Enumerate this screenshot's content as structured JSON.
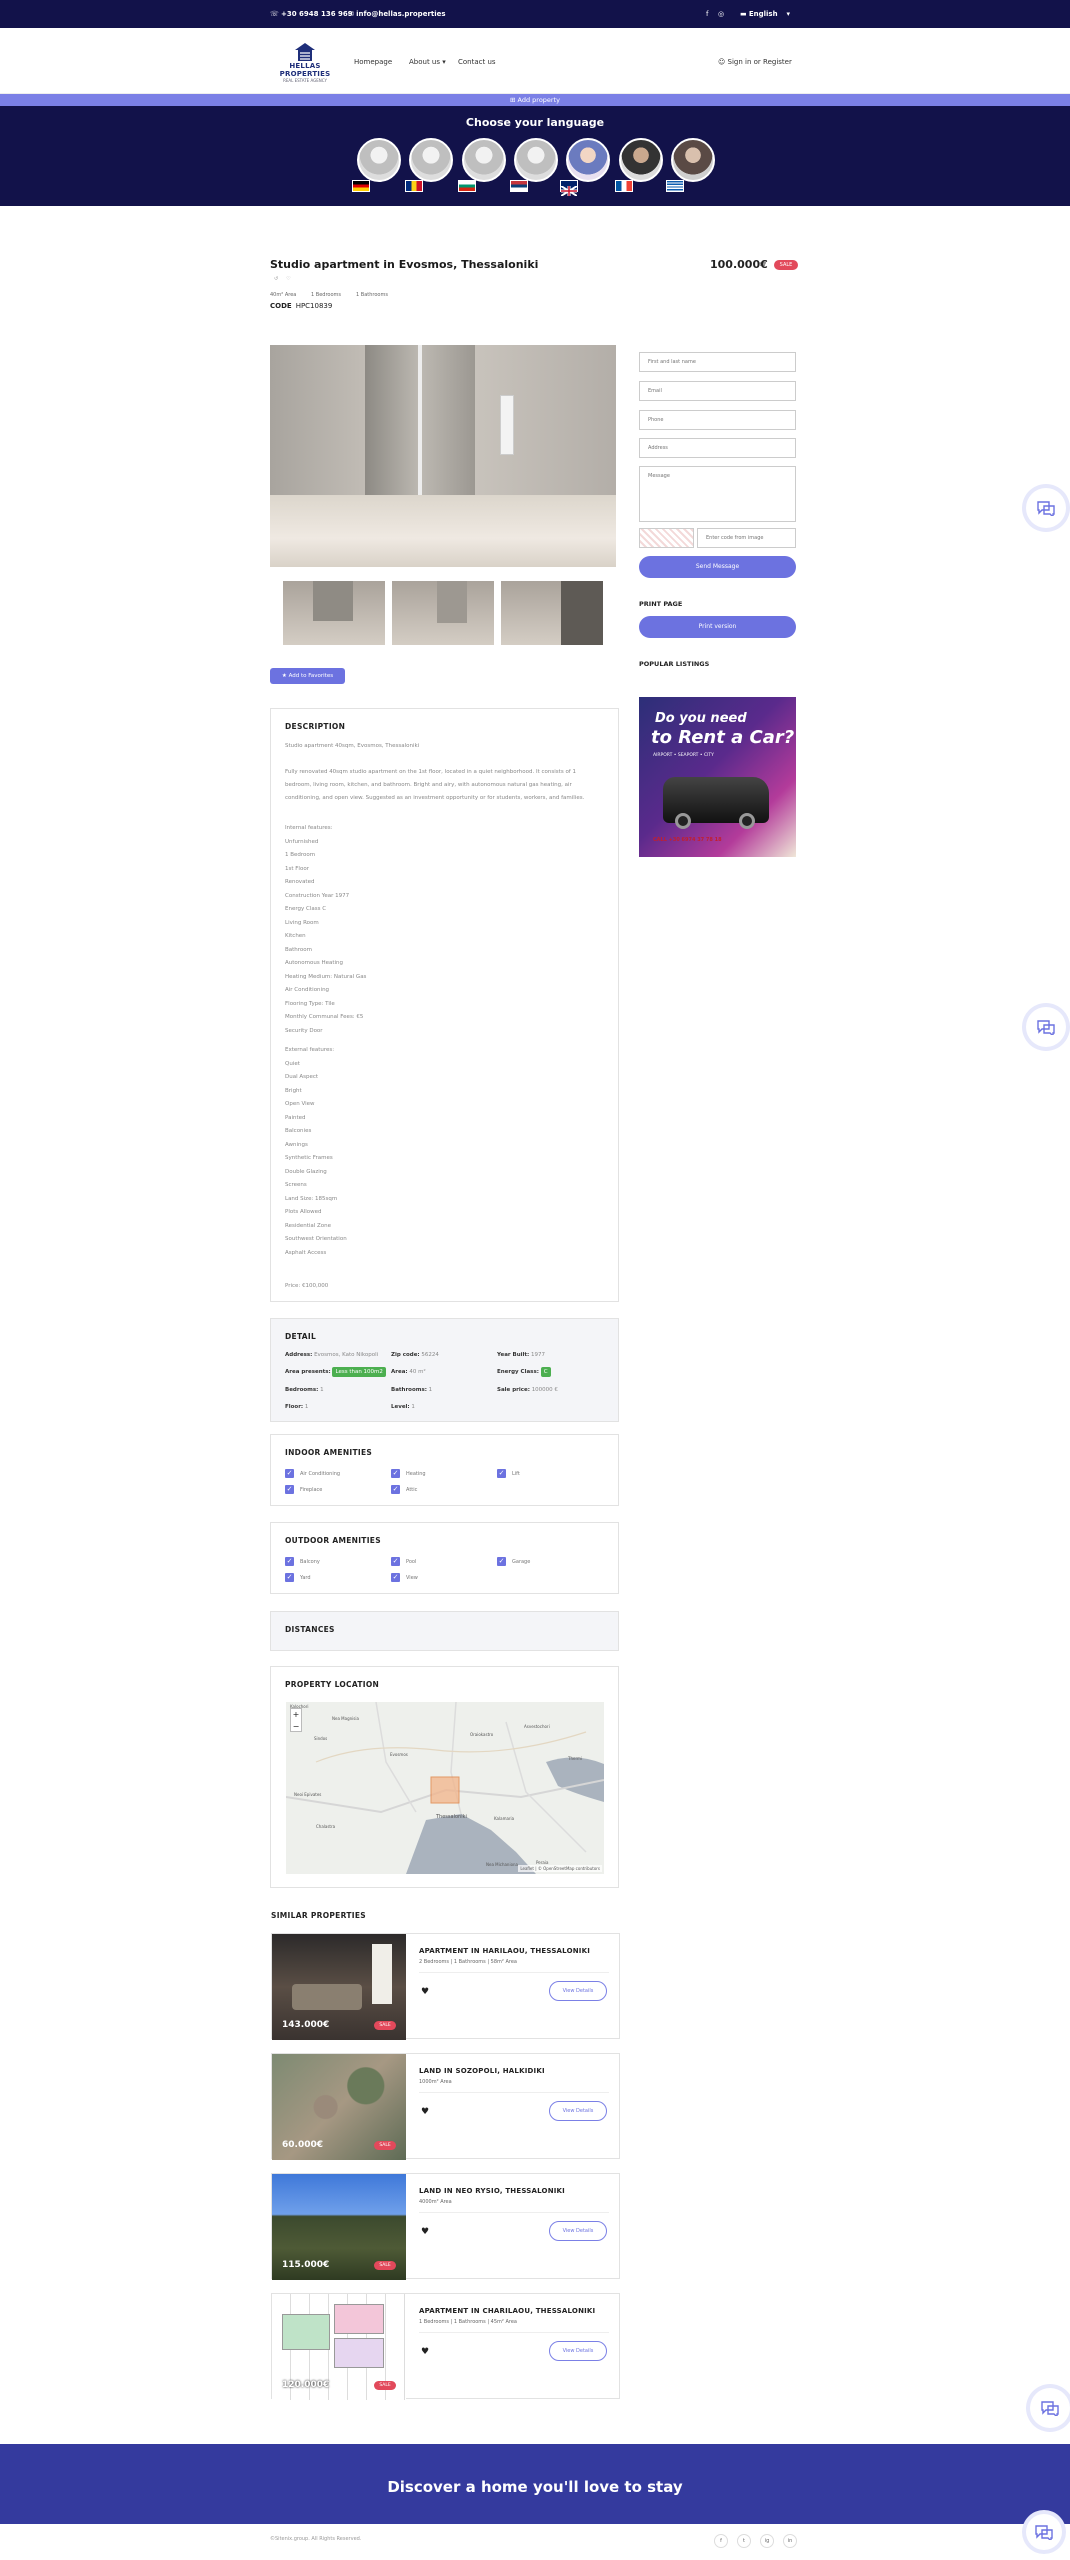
{
  "topbar": {
    "phone": "+30 6948 136 969",
    "email": "info@hellas.properties",
    "language": "English"
  },
  "header": {
    "logo_name": "HELLAS PROPERTIES",
    "logo_tag": "REAL ESTATE AGENCY",
    "nav": [
      "Homepage",
      "About us",
      "Contact us"
    ],
    "signin": "Sign in or Register"
  },
  "addbar": {
    "label": "Add property"
  },
  "language_bar": {
    "title": "Choose your language"
  },
  "property": {
    "title": "Studio apartment in Evosmos, Thessaloniki",
    "price": "100.000€",
    "badge": "SALE",
    "area": "40m² Area",
    "bedrooms": "1 Bedrooms",
    "bathrooms": "1 Bathrooms",
    "code_label": "CODE",
    "code_value": "HPC10839"
  },
  "favorites_button": "Add to Favorites",
  "description": {
    "title": "DESCRIPTION",
    "intro": "Studio apartment 40sqm, Evosmos, Thessaloniki",
    "para1": "Fully renovated 40sqm studio apartment on the 1st floor, located in a quiet neighborhood. It consists of 1",
    "para2": "bedroom, living room, kitchen, and bathroom. Bright and airy, with autonomous natural gas heating, air",
    "para3": "conditioning, and open view. Suggested as an investment opportunity or for students, workers, and families.",
    "internal": [
      "Internal features:",
      "Unfurnished",
      "1 Bedroom",
      "1st Floor",
      "Renovated",
      "Construction Year 1977",
      "Energy Class C",
      "Living Room",
      "Kitchen",
      "Bathroom",
      "Autonomous Heating",
      "Heating Medium: Natural Gas",
      "Air Conditioning",
      "Flooring Type: Tile",
      "Monthly Communal Fees: €5",
      "Security Door"
    ],
    "external": [
      "External features:",
      "Quiet",
      "Dual Aspect",
      "Bright",
      "Open View",
      "Painted",
      "Balconies",
      "Awnings",
      "Synthetic Frames",
      "Double Glazing",
      "Screens",
      "Land Size: 185sqm",
      "Plots Allowed",
      "Residential Zone",
      "Southwest Orientation",
      "Asphalt Access"
    ],
    "price_line": "Price: €100,000"
  },
  "detail": {
    "title": "DETAIL",
    "address_label": "Address:",
    "address": "Evosmos, Kato Nikopoli",
    "zip_label": "Zip code:",
    "zip": "56224",
    "year_label": "Year Built:",
    "year": "1977",
    "area_label": "Area presents:",
    "area_badge": "Less than 100m2",
    "areas_label": "Area:",
    "areas": "40 m²",
    "energy_label": "Energy Class:",
    "energy": "C",
    "bedrooms_label": "Bedrooms:",
    "bedrooms": "1",
    "bathrooms_label": "Bathrooms:",
    "bathrooms": "1",
    "sale_label": "Sale price:",
    "sale": "100000 €",
    "floor_label": "Floor:",
    "floor": "1",
    "level_label": "Level:",
    "level": "1"
  },
  "indoor": {
    "title": "INDOOR AMENITIES",
    "items": [
      "Air Conditioning",
      "Heating",
      "Lift",
      "Fireplace",
      "Attic"
    ]
  },
  "outdoor": {
    "title": "OUTDOOR AMENITIES",
    "items": [
      "Balcony",
      "Pool",
      "Garage",
      "Yard",
      "View"
    ]
  },
  "distances": {
    "title": "DISTANCES"
  },
  "location": {
    "title": "PROPERTY LOCATION",
    "zoom_in": "+",
    "zoom_out": "−",
    "labels": [
      "Kalochori",
      "Nea Magnisia",
      "Sindos",
      "Evosmos",
      "Oraiokastro",
      "Asvestochori",
      "Thermi",
      "Thessaloniki",
      "Kalamaria",
      "Neoi Epivates",
      "Peraia",
      "Nea Michaniona",
      "Chalastra"
    ],
    "attribution": "Leaflet | © OpenStreetMap contributors"
  },
  "contact_form": {
    "name_placeholder": "First and last name",
    "email_placeholder": "Email",
    "phone_placeholder": "Phone",
    "address_placeholder": "Address",
    "message_placeholder": "Message",
    "captcha_placeholder": "Enter code from image",
    "send_label": "Send Message"
  },
  "sidebar": {
    "print_title": "PRINT PAGE",
    "print_button": "Print version",
    "popular_title": "POPULAR LISTINGS"
  },
  "ad": {
    "line1": "Do you need",
    "line2": "to Rent a Car?",
    "tagline": "AIRPORT • SEAPORT • CITY",
    "phone": "CALL +30 6974 37 78 18"
  },
  "similar": {
    "title": "SIMILAR PROPERTIES",
    "view_label": "View Details",
    "items": [
      {
        "title": "APARTMENT IN HARILAOU, THESSALONIKI",
        "meta": "2 Bedrooms  |  1 Bathrooms  |  58m² Area",
        "price": "143.000€",
        "badge": "SALE"
      },
      {
        "title": "LAND IN SOZOPOLI, HALKIDIKI",
        "meta": "1000m² Area",
        "price": "60.000€",
        "badge": "SALE"
      },
      {
        "title": "LAND IN NEO RYSIO, THESSALONIKI",
        "meta": "4000m² Area",
        "price": "115.000€",
        "badge": "SALE"
      },
      {
        "title": "APARTMENT IN CHARILAOU, THESSALONIKI",
        "meta": "1 Bedrooms  |  1 Bathrooms  |  45m² Area",
        "price": "120.000€",
        "badge": "SALE"
      }
    ]
  },
  "footer": {
    "tagline": "Discover a home you'll love to stay",
    "copyright": "©Sitenix.group. All Rights Reserved."
  },
  "social": [
    "f",
    "t",
    "ig",
    "in"
  ],
  "colors": {
    "navy": "#12124a",
    "accent": "#6c72e0",
    "sale": "#e2495b",
    "footer": "#343a9e"
  }
}
